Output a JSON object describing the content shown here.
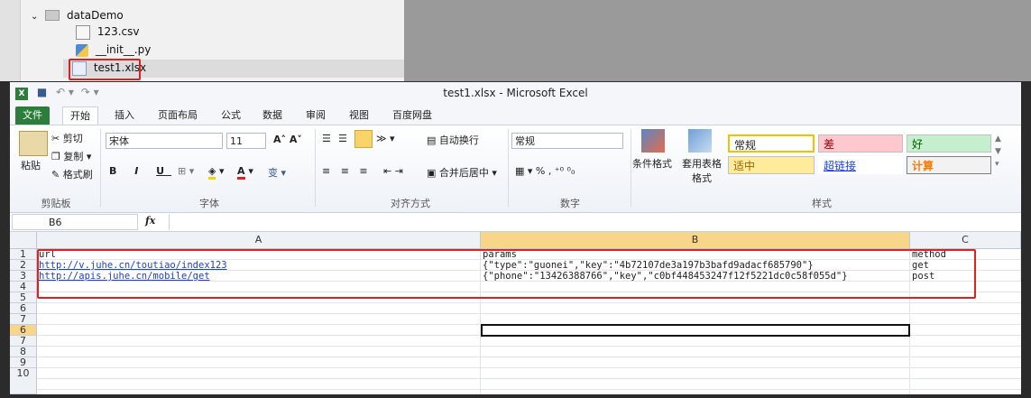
{
  "tree": {
    "folder": "dataDemo",
    "files": [
      "123.csv",
      "__init__.py",
      "test1.xlsx"
    ]
  },
  "excel": {
    "title": "test1.xlsx - Microsoft Excel",
    "tabs": [
      "文件",
      "开始",
      "插入",
      "页面布局",
      "公式",
      "数据",
      "审阅",
      "视图",
      "百度网盘"
    ],
    "clipboard": {
      "paste": "粘贴",
      "cut": "剪切",
      "copy": "复制 ▾",
      "format_painter": "格式刷",
      "label": "剪贴板"
    },
    "font": {
      "name": "宋体",
      "size": "11",
      "label": "字体"
    },
    "alignment": {
      "wrap": "自动换行",
      "merge": "合并后居中 ▾",
      "label": "对齐方式"
    },
    "number": {
      "format": "常规",
      "label": "数字"
    },
    "styles": {
      "cond_format": "条件格式",
      "table_format": "套用表格格式",
      "normal": "常规",
      "bad": "差",
      "good": "好",
      "neutral": "适中",
      "hyperlink": "超链接",
      "calc": "计算",
      "label": "样式"
    },
    "name_box": "B6",
    "fx": "fx",
    "columns": [
      "A",
      "B",
      "C"
    ],
    "rows": [
      "1",
      "2",
      "3",
      "4",
      "5",
      "6",
      "7",
      "8",
      "9",
      "10"
    ],
    "cells": {
      "r1": [
        "url",
        "params",
        "method"
      ],
      "r2": [
        "http://v.juhe.cn/toutiao/index123",
        "{\"type\":\"guonei\",\"key\":\"4b72107de3a197b3bafd9adacf685790\"}",
        "get"
      ],
      "r3": [
        "http://apis.juhe.cn/mobile/get",
        "{\"phone\":\"13426388766\",\"key\",\"c0bf448453247f12f5221dc0c58f055d\"}",
        "post"
      ]
    }
  },
  "colors": {
    "excel_green": "#2c7d3c",
    "highlight_red": "#e02020",
    "link_blue": "#1a3ed8"
  }
}
